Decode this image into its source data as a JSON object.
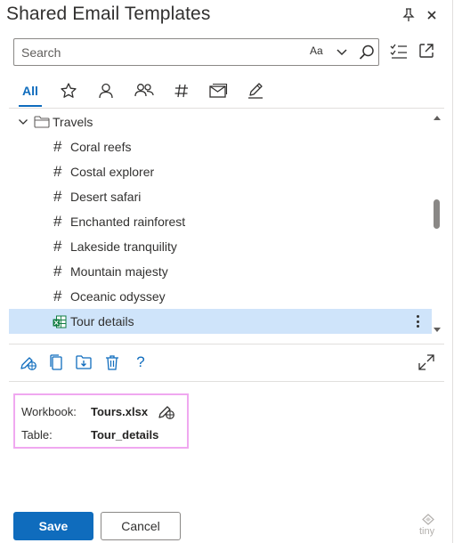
{
  "header": {
    "title": "Shared Email Templates",
    "pin_icon": "pin-icon",
    "close_icon": "close-icon"
  },
  "search": {
    "placeholder": "Search",
    "value": "",
    "match_case_label": "Aa"
  },
  "tabs": [
    {
      "label": "All",
      "icon": "",
      "active": true
    },
    {
      "label": "",
      "icon": "star-icon"
    },
    {
      "label": "",
      "icon": "person-icon"
    },
    {
      "label": "",
      "icon": "people-icon"
    },
    {
      "label": "",
      "icon": "hashtag-icon"
    },
    {
      "label": "",
      "icon": "envelope-icon"
    },
    {
      "label": "",
      "icon": "pen-icon"
    }
  ],
  "tree": {
    "folder": {
      "label": "Travels",
      "expanded": true
    },
    "items": [
      {
        "label": "Coral reefs",
        "type": "template"
      },
      {
        "label": "Costal explorer",
        "type": "template"
      },
      {
        "label": "Desert safari",
        "type": "template"
      },
      {
        "label": "Enchanted rainforest",
        "type": "template"
      },
      {
        "label": "Lakeside tranquility",
        "type": "template"
      },
      {
        "label": "Mountain majesty",
        "type": "template"
      },
      {
        "label": "Oceanic odyssey",
        "type": "template"
      },
      {
        "label": "Tour details",
        "type": "dataset",
        "selected": true
      }
    ],
    "hash_symbol": "#"
  },
  "details": {
    "workbook_label": "Workbook:",
    "workbook_value": "Tours.xlsx",
    "table_label": "Table:",
    "table_value": "Tour_details"
  },
  "footer": {
    "save_label": "Save",
    "cancel_label": "Cancel",
    "brand": "tiny"
  },
  "help_label": "?",
  "colors": {
    "accent": "#0f6cbd",
    "selection": "#cfe4fa",
    "highlight_border": "#f0a8f0",
    "excel_green": "#107c41"
  }
}
